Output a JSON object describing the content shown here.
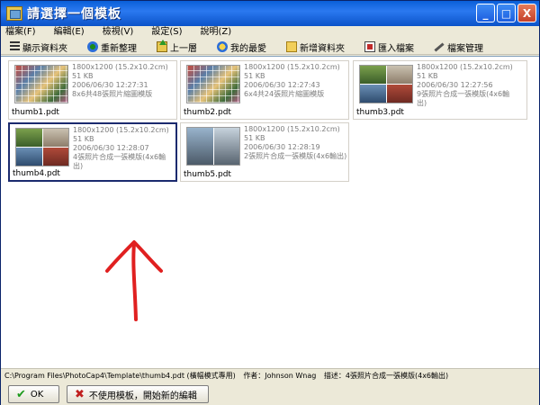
{
  "window": {
    "title": "請選擇一個模板",
    "buttons": [
      "_",
      "□",
      "X"
    ]
  },
  "menu": [
    "檔案(F)",
    "編輯(E)",
    "檢視(V)",
    "設定(S)",
    "說明(Z)"
  ],
  "toolbar": {
    "show_folder": "顯示資料夾",
    "refresh": "重新整理",
    "up": "上一層",
    "favorites": "我的最愛",
    "new_folder": "新增資料夾",
    "import": "匯入檔案",
    "manage": "檔案管理"
  },
  "templates": [
    {
      "name": "thumb1.pdt",
      "size": "1800x1200 (15.2x10.2cm)",
      "filesize": "51 KB",
      "date": "2006/06/30 12:27:31",
      "desc": "8x6共48張照片縮圖模版"
    },
    {
      "name": "thumb2.pdt",
      "size": "1800x1200 (15.2x10.2cm)",
      "filesize": "51 KB",
      "date": "2006/06/30 12:27:43",
      "desc": "6x4共24張照片縮圖模版"
    },
    {
      "name": "thumb3.pdt",
      "size": "1800x1200 (15.2x10.2cm)",
      "filesize": "51 KB",
      "date": "2006/06/30 12:27:56",
      "desc": "9張照片合成一張模版(4x6輸",
      "desc2": "出)"
    },
    {
      "name": "thumb4.pdt",
      "size": "1800x1200 (15.2x10.2cm)",
      "filesize": "51 KB",
      "date": "2006/06/30 12:28:07",
      "desc": "4張照片合成一張模版(4x6輸",
      "desc2": "出)"
    },
    {
      "name": "thumb5.pdt",
      "size": "1800x1200 (15.2x10.2cm)",
      "filesize": "51 KB",
      "date": "2006/06/30 12:28:19",
      "desc": "2張照片合成一張模版(4x6輸出)"
    }
  ],
  "status": {
    "path": "C:\\Program Files\\PhotoCap4\\Template\\thumb4.pdt (橫幅模式專用)",
    "author": "作者：Johnson Wnag",
    "desc": "描述：4張照片合成一張模版(4x6輸出)"
  },
  "buttons": {
    "ok": "OK",
    "new_edit": "不使用模板，開始新的編輯"
  },
  "colors": {
    "selection_border": "#1b2a6e",
    "annotation_arrow": "#e02020"
  }
}
